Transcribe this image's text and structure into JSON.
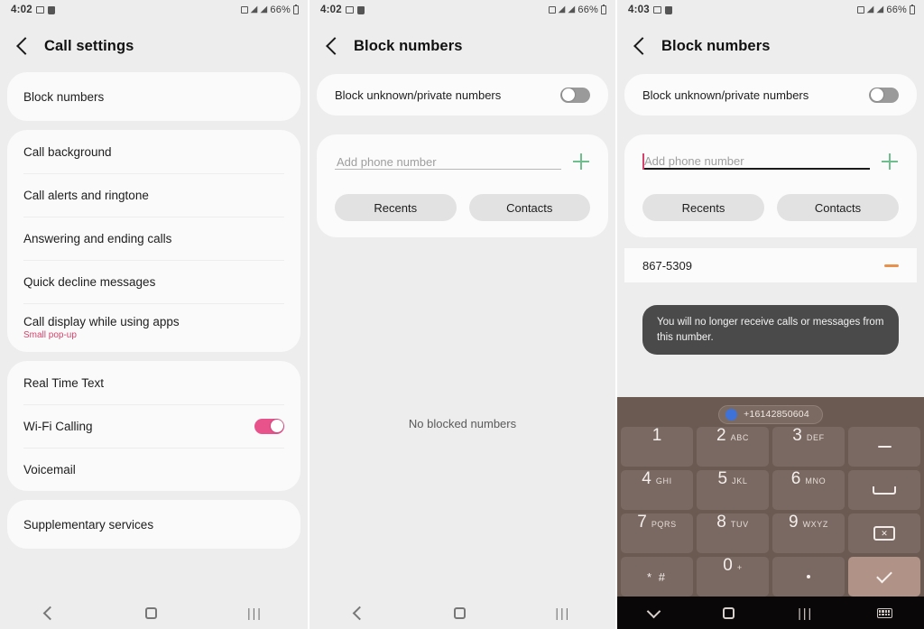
{
  "panels": [
    {
      "id": "call-settings",
      "status_bar": {
        "time": "4:02",
        "battery": "66%",
        "icons": [
          "photo-icon",
          "app-icon",
          "alarm-icon",
          "wifi-icon",
          "signal-icon",
          "battery-icon"
        ]
      },
      "appbar": {
        "back": "back-chevron",
        "title": "Call settings"
      },
      "groups": [
        {
          "items": [
            {
              "label": "Block numbers",
              "type": "nav"
            }
          ]
        },
        {
          "items": [
            {
              "label": "Call background",
              "type": "nav"
            },
            {
              "label": "Call alerts and ringtone",
              "type": "nav"
            },
            {
              "label": "Answering and ending calls",
              "type": "nav"
            },
            {
              "label": "Quick decline messages",
              "type": "nav"
            },
            {
              "label": "Call display while using apps",
              "sub": "Small pop-up",
              "type": "nav"
            }
          ]
        },
        {
          "items": [
            {
              "label": "Real Time Text",
              "type": "nav"
            },
            {
              "label": "Wi-Fi Calling",
              "type": "toggle",
              "toggle_state": "on"
            },
            {
              "label": "Voicemail",
              "type": "nav"
            }
          ]
        },
        {
          "items": [
            {
              "label": "Supplementary services",
              "type": "nav"
            }
          ]
        }
      ],
      "navbar": {
        "back": "back-icon",
        "home": "home-icon",
        "recents": "recents-icon"
      }
    },
    {
      "id": "block-numbers-empty",
      "status_bar": {
        "time": "4:02",
        "battery": "66%"
      },
      "appbar": {
        "back": "back-chevron",
        "title": "Block numbers"
      },
      "block_unknown": {
        "label": "Block unknown/private numbers",
        "toggle_state": "off"
      },
      "add": {
        "placeholder": "Add phone number",
        "value": "",
        "focused": false,
        "add_icon": "plus-icon"
      },
      "chips": [
        "Recents",
        "Contacts"
      ],
      "empty_state": "No blocked numbers",
      "blocked_numbers": [],
      "navbar": {
        "back": "back-icon",
        "home": "home-icon",
        "recents": "recents-icon"
      }
    },
    {
      "id": "block-numbers-added",
      "status_bar": {
        "time": "4:03",
        "battery": "66%"
      },
      "appbar": {
        "back": "back-chevron",
        "title": "Block numbers"
      },
      "block_unknown": {
        "label": "Block unknown/private numbers",
        "toggle_state": "off"
      },
      "add": {
        "placeholder": "Add phone number",
        "value": "",
        "focused": true,
        "add_icon": "plus-icon"
      },
      "chips": [
        "Recents",
        "Contacts"
      ],
      "blocked_numbers": [
        {
          "number": "867-5309",
          "remove_icon": "minus-icon"
        }
      ],
      "toast": "You will no longer receive calls or messages from this number.",
      "keypad": {
        "suggestion": "+16142850604",
        "keys": [
          [
            {
              "num": "1",
              "letters": ""
            },
            {
              "num": "2",
              "letters": "ABC"
            },
            {
              "num": "3",
              "letters": "DEF"
            },
            {
              "glyph": "dash",
              "name": "dash-key"
            }
          ],
          [
            {
              "num": "4",
              "letters": "GHI"
            },
            {
              "num": "5",
              "letters": "JKL"
            },
            {
              "num": "6",
              "letters": "MNO"
            },
            {
              "glyph": "space",
              "name": "space-key"
            }
          ],
          [
            {
              "num": "7",
              "letters": "PQRS"
            },
            {
              "num": "8",
              "letters": "TUV"
            },
            {
              "num": "9",
              "letters": "WXYZ"
            },
            {
              "glyph": "backspace",
              "name": "backspace-key"
            }
          ],
          [
            {
              "sym": "* #",
              "name": "star-hash-key"
            },
            {
              "num": "0",
              "letters": "+"
            },
            {
              "glyph": "dot",
              "name": "period-key"
            },
            {
              "glyph": "check",
              "name": "enter-key"
            }
          ]
        ]
      },
      "navbar": {
        "down": "chevron-down-icon",
        "home": "home-icon",
        "recents": "recents-icon",
        "keyboard": "keyboard-icon"
      }
    }
  ],
  "colors": {
    "toggle_on": "#e8538c",
    "toggle_off": "#9a9a9a",
    "plus": "#6fbf8e",
    "minus": "#e8914d",
    "subtext": "#d4436c",
    "keypad_bg": "#6b5a52",
    "key_bg": "#7a6962",
    "enter_key": "#b09286",
    "toast_bg": "#4a4a4a"
  }
}
